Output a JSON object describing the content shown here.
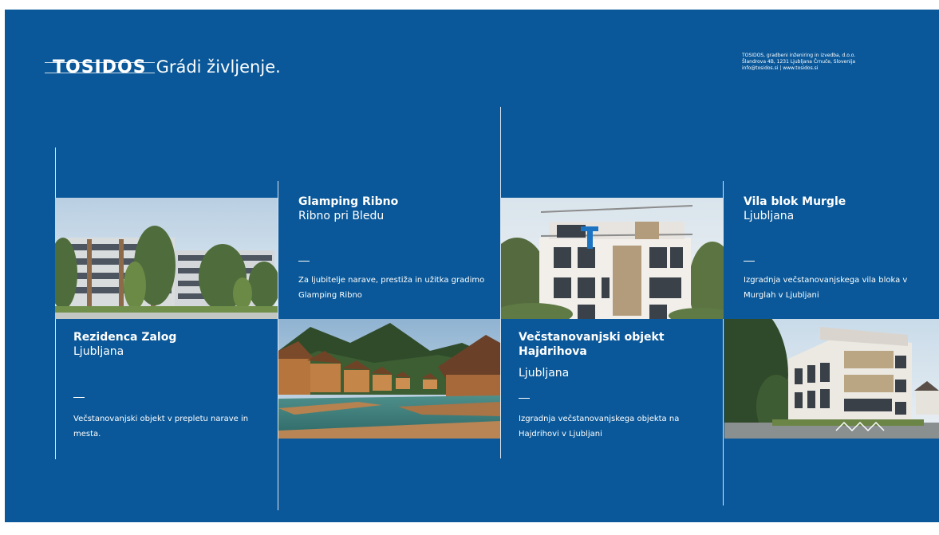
{
  "brand": {
    "logo_text": "TOSIDOS",
    "tagline": "Grádi življenje.",
    "company_lines": [
      "TOSIDOS, gradbeni inženiring in izvedba, d.o.o.",
      "Šlandrova 4B, 1231 Ljubljana Črnuče, Slovenija",
      "info@tosidos.si  |  www.tosidos.si"
    ]
  },
  "colors": {
    "background": "#0a5899",
    "text": "#ffffff"
  },
  "projects": [
    {
      "title": "Rezidenca Zalog",
      "location": "Ljubljana",
      "description": "Večstanovanjski objekt v prepletu narave in mesta.",
      "image": "residential-complex-photo"
    },
    {
      "title": "Glamping Ribno",
      "location": "Ribno pri Bledu",
      "description": "Za ljubitelje narave, prestiža in užitka gradimo Glamping Ribno",
      "image": "glamping-cabins-photo"
    },
    {
      "title": "Večstanovanjski objekt Hajdrihova",
      "location": "Ljubljana",
      "description": "Izgradnja večstanovanjskega objekta na Hajdrihovi v Ljubljani",
      "image": "apartment-building-photo"
    },
    {
      "title": "Vila blok Murgle",
      "location": "Ljubljana",
      "description": "Izgradnja večstanovanjskega vila bloka v Murglah v Ljubljani",
      "image": "villa-block-photo"
    }
  ]
}
